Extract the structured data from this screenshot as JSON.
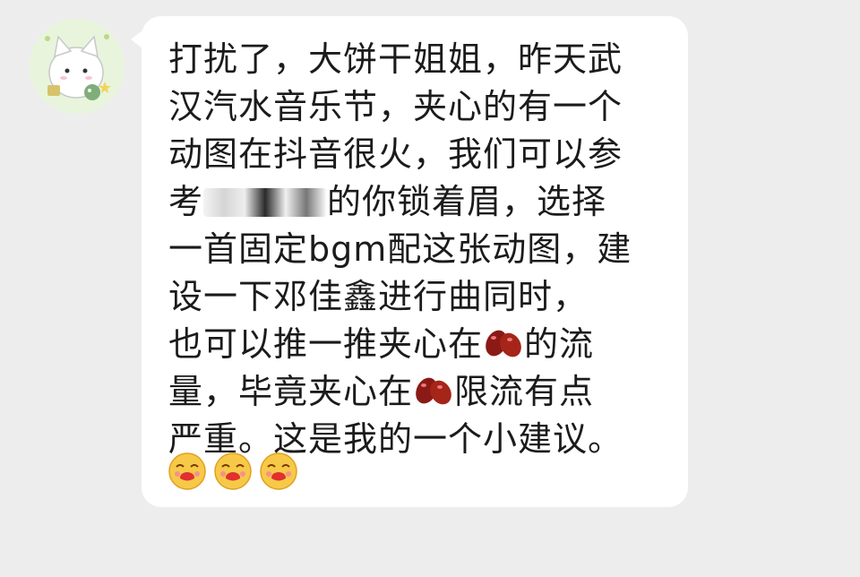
{
  "message": {
    "lines": [
      "打扰了，大饼干姐姐，昨天武",
      "汉汽水音乐节，夹心的有一个",
      "动图在抖音很火，我们可以参",
      "考",
      "的你锁着眉，选择",
      "一首固定bgm配这张动图，建",
      "设一下邓佳鑫进行曲同时，",
      "也可以推一推夹心在",
      "的流",
      "量，毕竟夹心在",
      "限流有点",
      "严重。这是我的一个小建议。"
    ]
  },
  "colors": {
    "background": "#ededed",
    "bubble": "#ffffff",
    "text": "#1b1b1b"
  },
  "icons": [
    "avatar-cat-icon",
    "red-bean-icon",
    "red-bean-icon",
    "kiss-face-icon",
    "kiss-face-icon",
    "kiss-face-icon"
  ]
}
